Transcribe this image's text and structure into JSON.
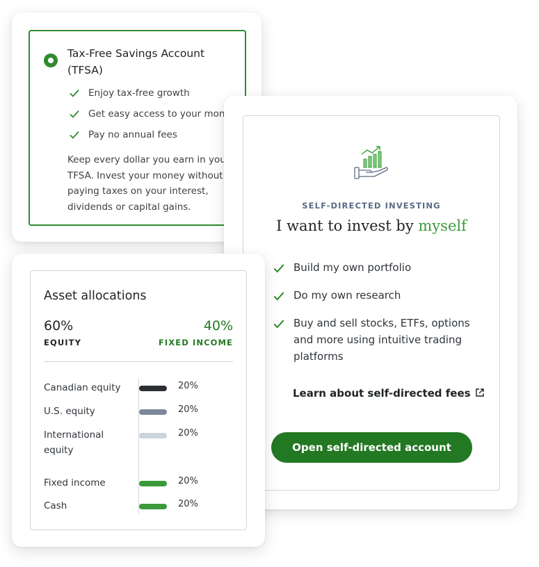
{
  "tfsa": {
    "title": "Tax-Free Savings Account (TFSA)",
    "benefits": [
      "Enjoy tax-free growth",
      "Get easy access to your money",
      "Pay no annual fees"
    ],
    "description": "Keep every dollar you earn in your TFSA. Invest your money without paying taxes on your interest, dividends or capital gains."
  },
  "self_directed": {
    "icon": "growth-chart-hand-icon",
    "eyebrow": "SELF-DIRECTED INVESTING",
    "heading_prefix": "I want to invest by ",
    "heading_accent": "myself",
    "features": [
      "Build my own portfolio",
      "Do my own research",
      "Buy and sell stocks, ETFs, options and more using intuitive trading platforms"
    ],
    "fees_link": "Learn about self-directed fees",
    "cta_button": "Open self-directed account"
  },
  "asset_allocation": {
    "title": "Asset allocations",
    "equity_percent": "60%",
    "equity_label": "EQUITY",
    "fixed_income_percent": "40%",
    "fixed_income_label": "FIXED INCOME",
    "rows": [
      {
        "name": "Canadian equity",
        "value": "20%",
        "color": "#2b2f33"
      },
      {
        "name": "U.S. equity",
        "value": "20%",
        "color": "#7d8799"
      },
      {
        "name": "International equity",
        "value": "20%",
        "color": "#ccd3db"
      },
      {
        "name": "Fixed income",
        "value": "20%",
        "color": "#3a9a3a"
      },
      {
        "name": "Cash",
        "value": "20%",
        "color": "#3a9a3a"
      }
    ]
  },
  "colors": {
    "brand_green": "#237823",
    "accent_green": "#3a9a3a",
    "border": "#cfd3d7"
  }
}
